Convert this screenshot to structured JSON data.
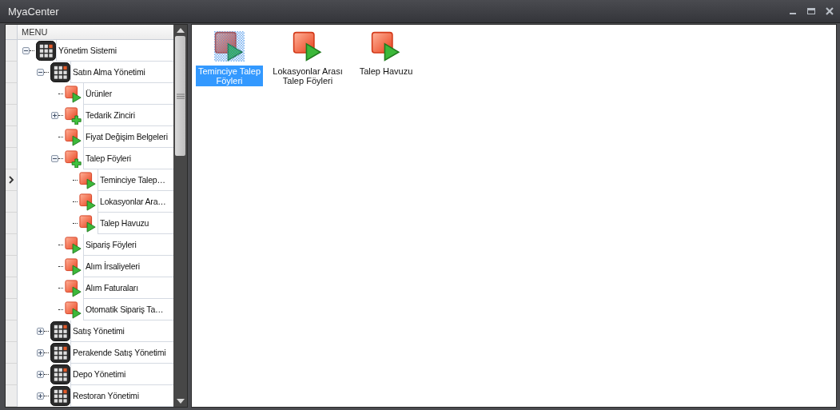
{
  "window": {
    "title": "MyaCenter"
  },
  "menu": {
    "header": "MENU",
    "items": [
      {
        "label": "Yönetim Sistemi",
        "kind": "module",
        "expanded": true,
        "selected": false,
        "children": [
          {
            "label": "Satın Alma Yönetimi",
            "kind": "module",
            "expanded": true,
            "selected": false,
            "children": [
              {
                "label": "Ürünler",
                "kind": "form",
                "selected": false
              },
              {
                "label": "Tedarik Zinciri",
                "kind": "group",
                "expanded": false,
                "selected": false
              },
              {
                "label": "Fiyat Değişim Belgeleri",
                "kind": "form",
                "selected": false
              },
              {
                "label": "Talep Föyleri",
                "kind": "group",
                "expanded": true,
                "selected": false,
                "children": [
                  {
                    "label": "Teminciye Talep…",
                    "kind": "form",
                    "selected": true
                  },
                  {
                    "label": "Lokasyonlar Ara…",
                    "kind": "form",
                    "selected": false
                  },
                  {
                    "label": "Talep Havuzu",
                    "kind": "form",
                    "selected": false
                  }
                ]
              },
              {
                "label": "Sipariş Föyleri",
                "kind": "form",
                "selected": false
              },
              {
                "label": "Alım İrsaliyeleri",
                "kind": "form",
                "selected": false
              },
              {
                "label": "Alım Faturaları",
                "kind": "form",
                "selected": false
              },
              {
                "label": "Otomatik Sipariş Ta…",
                "kind": "form",
                "selected": false
              }
            ]
          },
          {
            "label": "Satış Yönetimi",
            "kind": "module",
            "expanded": false,
            "selected": false
          },
          {
            "label": "Perakende Satış Yönetimi",
            "kind": "module",
            "expanded": false,
            "selected": false
          },
          {
            "label": "Depo Yönetimi",
            "kind": "module",
            "expanded": false,
            "selected": false
          },
          {
            "label": "Restoran Yönetimi",
            "kind": "module",
            "expanded": false,
            "selected": false
          }
        ]
      }
    ]
  },
  "tiles": [
    {
      "label": "Teminciye Talep Föyleri",
      "selected": true
    },
    {
      "label": "Lokasyonlar Arası Talep Föyleri",
      "selected": false
    },
    {
      "label": "Talep Havuzu",
      "selected": false
    }
  ]
}
